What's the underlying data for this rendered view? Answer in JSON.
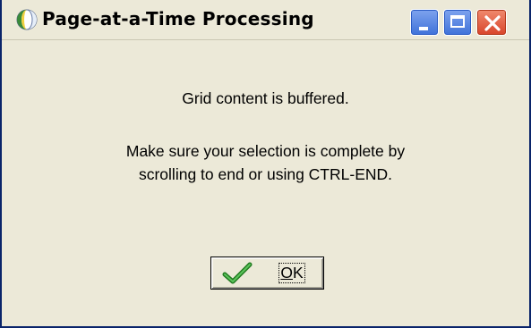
{
  "window": {
    "title": "Page-at-a-Time Processing",
    "title_icon": "globe-icon",
    "controls": {
      "minimize_icon": "minimize-icon",
      "maximize_icon": "maximize-icon",
      "close_icon": "close-icon"
    },
    "colors": {
      "body_background": "#ece9d8",
      "border": "#0a246a",
      "close_button": "#d8442a",
      "title_buttons": "#3f72d9"
    }
  },
  "dialog": {
    "message_line1": "Grid content is buffered.",
    "message_line2": "Make sure your selection is complete by",
    "message_line3": "scrolling to end or using CTRL-END.",
    "ok_button": {
      "icon": "checkmark-icon",
      "label_mnemonic": "O",
      "label_rest": "K"
    }
  }
}
